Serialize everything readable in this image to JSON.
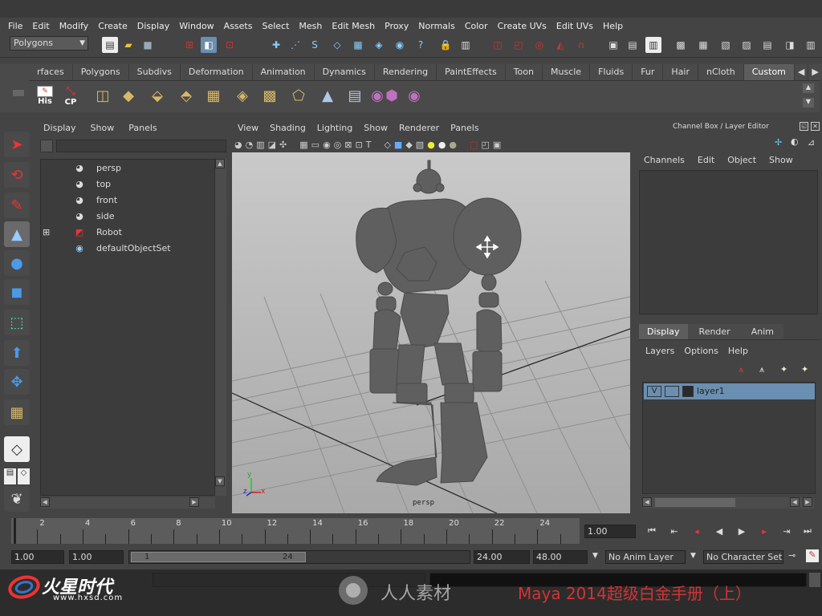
{
  "menu": [
    "File",
    "Edit",
    "Modify",
    "Create",
    "Display",
    "Window",
    "Assets",
    "Select",
    "Mesh",
    "Edit Mesh",
    "Proxy",
    "Normals",
    "Color",
    "Create UVs",
    "Edit UVs",
    "Help"
  ],
  "mode_selector": "Polygons",
  "shelf_tabs": [
    "rfaces",
    "Polygons",
    "Subdivs",
    "Deformation",
    "Animation",
    "Dynamics",
    "Rendering",
    "PaintEffects",
    "Toon",
    "Muscle",
    "Fluids",
    "Fur",
    "Hair",
    "nCloth",
    "Custom"
  ],
  "active_shelf_tab": "Custom",
  "shelf_labels": {
    "his": "His",
    "cp": "CP"
  },
  "outliner": {
    "menu": [
      "Display",
      "Show",
      "Panels"
    ],
    "items": [
      {
        "label": "persp",
        "icon": "camera-icon"
      },
      {
        "label": "top",
        "icon": "camera-icon"
      },
      {
        "label": "front",
        "icon": "camera-icon"
      },
      {
        "label": "side",
        "icon": "camera-icon"
      },
      {
        "label": "Robot",
        "icon": "mesh-icon"
      },
      {
        "label": "defaultObjectSet",
        "icon": "set-icon"
      }
    ]
  },
  "viewport": {
    "menu": [
      "View",
      "Shading",
      "Lighting",
      "Show",
      "Renderer",
      "Panels"
    ],
    "camera_label": "persp",
    "axis": {
      "x": "x",
      "y": "y",
      "z": "z"
    }
  },
  "channel_box": {
    "title": "Channel Box / Layer Editor",
    "menu": [
      "Channels",
      "Edit",
      "Object",
      "Show"
    ]
  },
  "layer_editor": {
    "tabs": [
      "Display",
      "Render",
      "Anim"
    ],
    "menu": [
      "Layers",
      "Options",
      "Help"
    ],
    "layer": {
      "visible": "V",
      "name": "layer1"
    }
  },
  "timeline": {
    "labels": [
      "2",
      "4",
      "6",
      "8",
      "10",
      "12",
      "14",
      "16",
      "18",
      "20",
      "22",
      "24"
    ],
    "current_frame": "1.00"
  },
  "range": {
    "start": "1.00",
    "playback_start": "1.00",
    "slider_start": "1",
    "slider_end": "24",
    "playback_end": "24.00",
    "end": "48.00",
    "anim_layer": "No Anim Layer",
    "character_set": "No Character Set"
  },
  "watermark": {
    "logo_text": "火星时代",
    "logo_url": "www.hxsd.com",
    "site_text": "人人素材",
    "title": "Maya 2014超级白金手册（上）"
  },
  "colors": {
    "bg": "#444444",
    "layer_highlight": "#6a8fb0",
    "watermark_red": "#d23333"
  }
}
